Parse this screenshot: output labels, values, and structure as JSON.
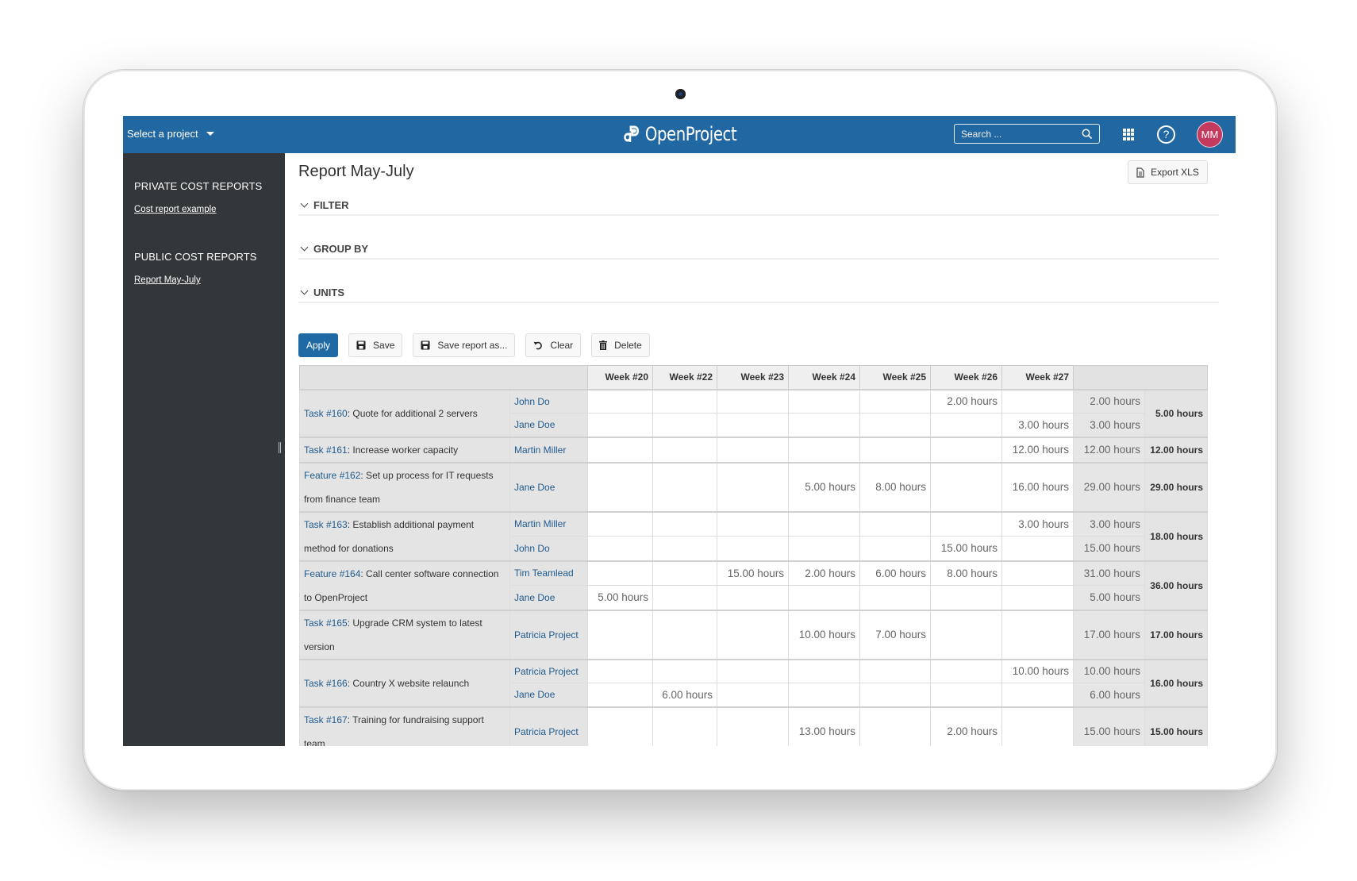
{
  "header": {
    "project_select": "Select a project",
    "logo_text": "OpenProject",
    "search_placeholder": "Search ...",
    "avatar_initials": "MM",
    "help_symbol": "?"
  },
  "sidebar": {
    "sections": [
      {
        "title": "PRIVATE COST REPORTS",
        "links": [
          "Cost report example"
        ]
      },
      {
        "title": "PUBLIC COST REPORTS",
        "links": [
          "Report May-July"
        ]
      }
    ]
  },
  "page": {
    "title": "Report May-July",
    "export_label": "Export XLS",
    "sections": [
      "FILTER",
      "GROUP BY",
      "UNITS"
    ]
  },
  "toolbar": {
    "apply": "Apply",
    "save": "Save",
    "save_as": "Save report as...",
    "clear": "Clear",
    "delete": "Delete"
  },
  "table": {
    "weeks": [
      "Week #20",
      "Week #22",
      "Week #23",
      "Week #24",
      "Week #25",
      "Week #26",
      "Week #27"
    ],
    "groups": [
      {
        "task_link": "Task #160",
        "task_title": ": Quote for additional 2 servers",
        "total": "5.00 hours",
        "rows": [
          {
            "user": "John Do",
            "values": [
              "",
              "",
              "",
              "",
              "",
              "2.00 hours",
              ""
            ],
            "subtotal": "2.00 hours"
          },
          {
            "user": "Jane Doe",
            "values": [
              "",
              "",
              "",
              "",
              "",
              "",
              "3.00 hours"
            ],
            "subtotal": "3.00 hours"
          }
        ]
      },
      {
        "task_link": "Task #161",
        "task_title": ": Increase worker capacity",
        "total": "12.00 hours",
        "rows": [
          {
            "user": "Martin Miller",
            "values": [
              "",
              "",
              "",
              "",
              "",
              "",
              "12.00 hours"
            ],
            "subtotal": "12.00 hours"
          }
        ]
      },
      {
        "task_link": "Feature #162",
        "task_title": ": Set up process for IT requests from finance team",
        "total": "29.00 hours",
        "rows": [
          {
            "user": "Jane Doe",
            "values": [
              "",
              "",
              "",
              "5.00 hours",
              "8.00 hours",
              "",
              "16.00 hours"
            ],
            "subtotal": "29.00 hours"
          }
        ]
      },
      {
        "task_link": "Task #163",
        "task_title": ": Establish additional payment method for donations",
        "total": "18.00 hours",
        "rows": [
          {
            "user": "Martin Miller",
            "values": [
              "",
              "",
              "",
              "",
              "",
              "",
              "3.00 hours"
            ],
            "subtotal": "3.00 hours"
          },
          {
            "user": "John Do",
            "values": [
              "",
              "",
              "",
              "",
              "",
              "15.00 hours",
              ""
            ],
            "subtotal": "15.00 hours"
          }
        ]
      },
      {
        "task_link": "Feature #164",
        "task_title": ": Call center software connection to OpenProject",
        "total": "36.00 hours",
        "rows": [
          {
            "user": "Tim Teamlead",
            "values": [
              "",
              "",
              "15.00 hours",
              "2.00 hours",
              "6.00 hours",
              "8.00 hours",
              ""
            ],
            "subtotal": "31.00 hours"
          },
          {
            "user": "Jane Doe",
            "values": [
              "5.00 hours",
              "",
              "",
              "",
              "",
              "",
              ""
            ],
            "subtotal": "5.00 hours"
          }
        ]
      },
      {
        "task_link": "Task #165",
        "task_title": ": Upgrade CRM system to latest version",
        "total": "17.00 hours",
        "rows": [
          {
            "user": "Patricia Project",
            "values": [
              "",
              "",
              "",
              "10.00 hours",
              "7.00 hours",
              "",
              ""
            ],
            "subtotal": "17.00 hours"
          }
        ]
      },
      {
        "task_link": "Task #166",
        "task_title": ": Country X website relaunch",
        "total": "16.00 hours",
        "rows": [
          {
            "user": "Patricia Project",
            "values": [
              "",
              "",
              "",
              "",
              "",
              "",
              "10.00 hours"
            ],
            "subtotal": "10.00 hours"
          },
          {
            "user": "Jane Doe",
            "values": [
              "",
              "6.00 hours",
              "",
              "",
              "",
              "",
              ""
            ],
            "subtotal": "6.00 hours"
          }
        ]
      },
      {
        "task_link": "Task #167",
        "task_title": ": Training for fundraising support team",
        "total": "15.00 hours",
        "rows": [
          {
            "user": "Patricia Project",
            "values": [
              "",
              "",
              "",
              "13.00 hours",
              "",
              "2.00 hours",
              ""
            ],
            "subtotal": "15.00 hours"
          }
        ]
      }
    ]
  },
  "colors": {
    "header_bg": "#2167a2",
    "sidebar_bg": "#333739",
    "link": "#1f5a8e",
    "primary_button": "#1f6aa5",
    "avatar": "#c4395e"
  }
}
